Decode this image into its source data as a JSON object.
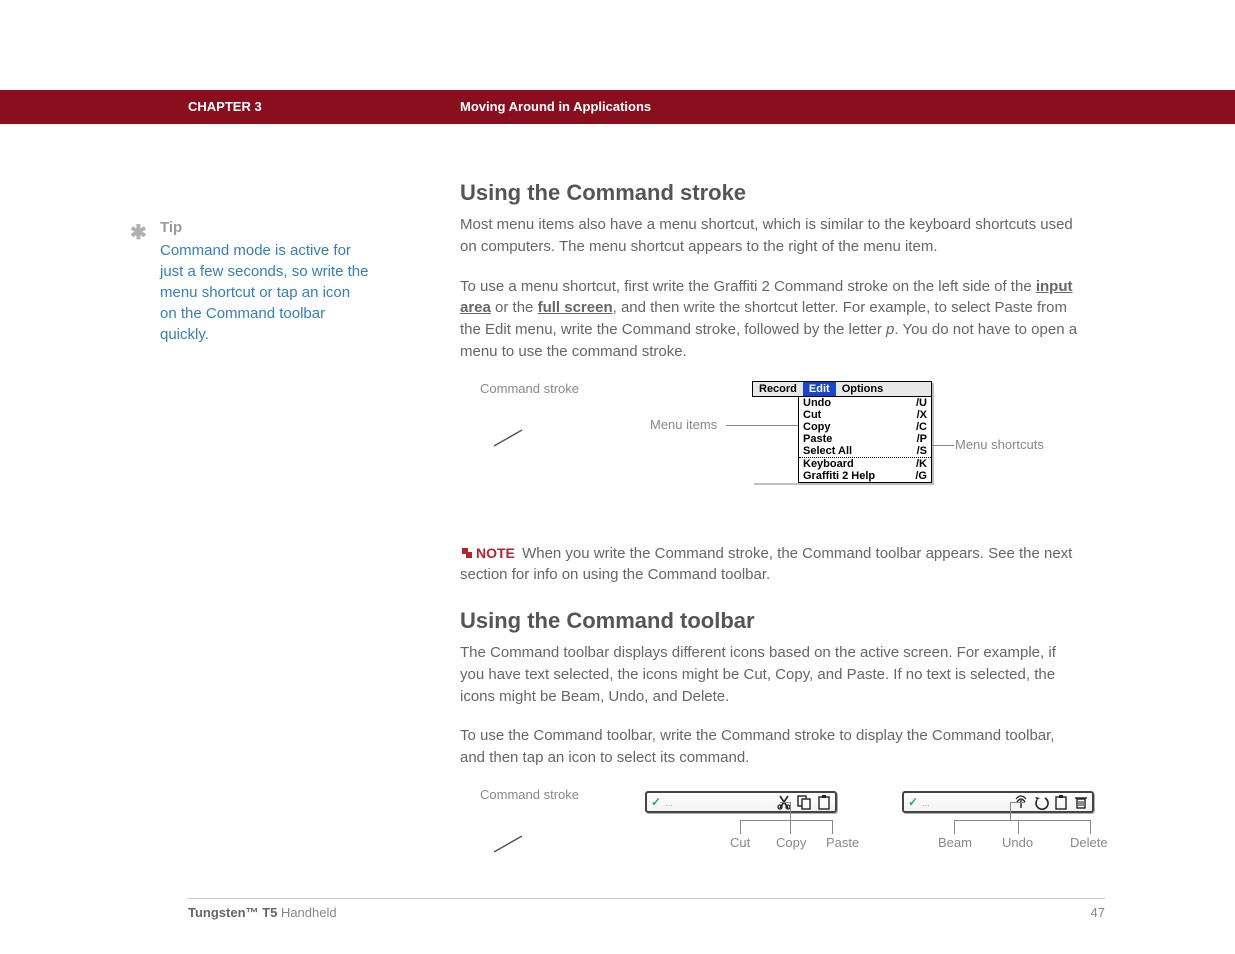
{
  "header": {
    "chapter": "CHAPTER 3",
    "title": "Moving Around in Applications"
  },
  "tip": {
    "label": "Tip",
    "body": "Command mode is active for just a few seconds, so write the menu shortcut or tap an icon on the Command toolbar quickly."
  },
  "section1": {
    "heading": "Using the Command stroke",
    "p1": "Most menu items also have a menu shortcut, which is similar to the keyboard shortcuts used on computers. The menu shortcut appears to the right of the menu item.",
    "p2a": "To use a menu shortcut, first write the Graffiti 2 Command stroke on the left side of the ",
    "link1": "input area",
    "p2b": " or the ",
    "link2": "full screen",
    "p2c": ", and then write the shortcut letter. For example, to select Paste from the Edit menu, write the Command stroke, followed by the letter ",
    "p2d_italic": "p",
    "p2e": ". You do not have to open a menu to use the command stroke."
  },
  "figure1": {
    "cmd_stroke": "Command stroke",
    "menu_items": "Menu items",
    "menu_shortcuts": "Menu shortcuts",
    "menu": {
      "tabs": [
        "Record",
        "Edit",
        "Options"
      ],
      "rows": [
        {
          "label": "Undo",
          "sc": "/U"
        },
        {
          "label": "Cut",
          "sc": "/X"
        },
        {
          "label": "Copy",
          "sc": "/C"
        },
        {
          "label": "Paste",
          "sc": "/P"
        },
        {
          "label": "Select All",
          "sc": "/S"
        },
        {
          "label": "Keyboard",
          "sc": "/K"
        },
        {
          "label": "Graffiti 2 Help",
          "sc": "/G"
        }
      ]
    }
  },
  "note": {
    "label": "NOTE",
    "text": " When you write the Command stroke, the Command toolbar appears. See the next section for info on using the Command toolbar."
  },
  "section2": {
    "heading": "Using the Command toolbar",
    "p1": "The Command toolbar displays different icons based on the active screen. For example, if you have text selected, the icons might be Cut, Copy, and Paste. If no text is selected, the icons might be Beam, Undo, and Delete.",
    "p2": "To use the Command toolbar, write the Command stroke to display the Command toolbar, and then tap an icon to select its command."
  },
  "figure2": {
    "cmd_stroke": "Command stroke",
    "labels_a": [
      "Cut",
      "Copy",
      "Paste"
    ],
    "labels_b": [
      "Beam",
      "Undo",
      "Delete"
    ]
  },
  "footer": {
    "product_bold": "Tungsten™ T5",
    "product_rest": " Handheld",
    "page": "47"
  }
}
